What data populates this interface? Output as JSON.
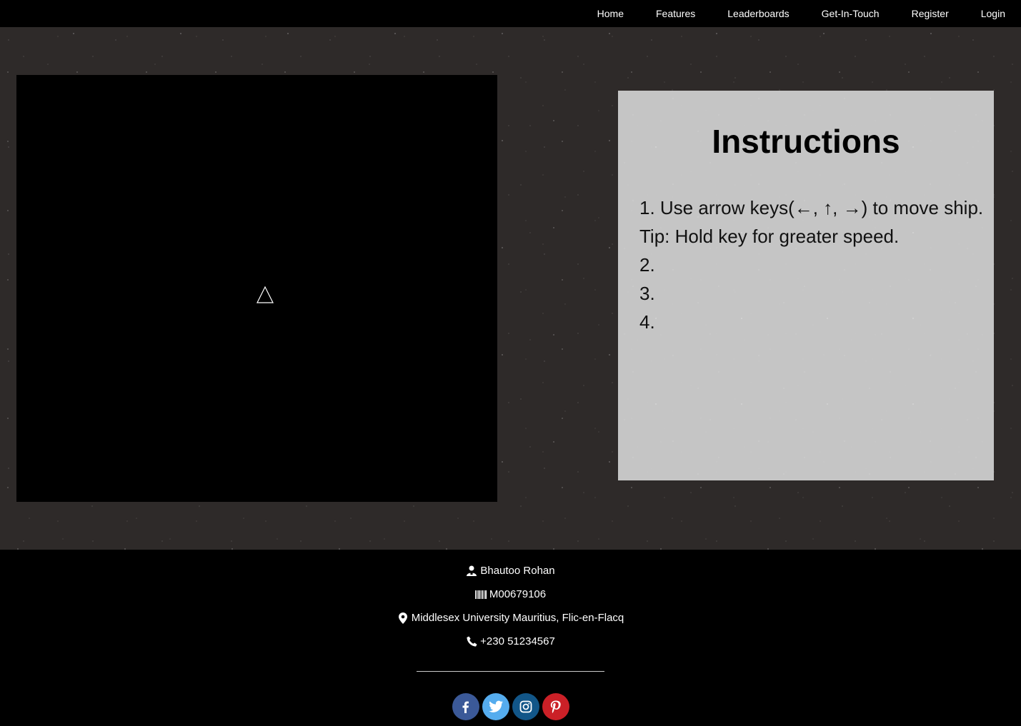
{
  "nav": {
    "links": [
      "Home",
      "Features",
      "Leaderboards",
      "Get-In-Touch",
      "Register",
      "Login"
    ]
  },
  "game": {
    "ship_icon": "triangle-ship-icon"
  },
  "instructions": {
    "title": "Instructions",
    "lines": [
      "1. Use arrow keys(←, ↑, →) to move ship.",
      "Tip: Hold key for greater speed.",
      "2.",
      "3.",
      "4."
    ]
  },
  "footer": {
    "name": "Bhautoo Rohan",
    "student_id": "M00679106",
    "location": "Middlesex University Mauritius, Flic-en-Flacq",
    "phone": "+230 51234567",
    "socials": [
      {
        "icon": "facebook-icon",
        "color": "#3b5998"
      },
      {
        "icon": "twitter-icon",
        "color": "#55acee"
      },
      {
        "icon": "instagram-icon",
        "color": "#125688"
      },
      {
        "icon": "pinterest-icon",
        "color": "#cb2027"
      }
    ]
  }
}
